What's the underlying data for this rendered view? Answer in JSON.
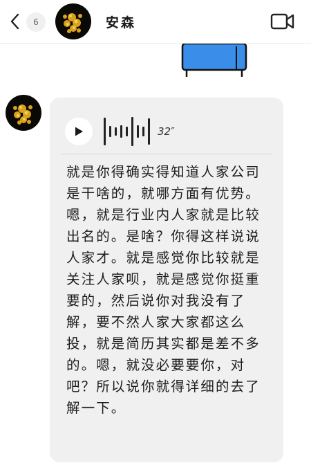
{
  "header": {
    "back_icon": "chevron-left-icon",
    "unread_count": "6",
    "contact_name": "安森",
    "video_icon": "video-call-icon"
  },
  "messages": [
    {
      "type": "voice",
      "duration": "32″",
      "play_icon": "play-icon",
      "transcript": "就是你得确实得知道人家公司是干啥的，就哪方面有优势。嗯，就是行业内人家就是比较出名的。是啥？你得这样说说人家才。就是感觉你比较就是关注人家呗，就是感觉你挺重要的，然后说你对我没有了解，要不然人家大家都这么投，就是简历其实都是差不多的。嗯，就没必要要你，对吧？所以说你就得详细的去了解一下。"
    }
  ],
  "colors": {
    "bubble": "#f0f0f1",
    "prev_image_blue": "#3a8de8"
  }
}
